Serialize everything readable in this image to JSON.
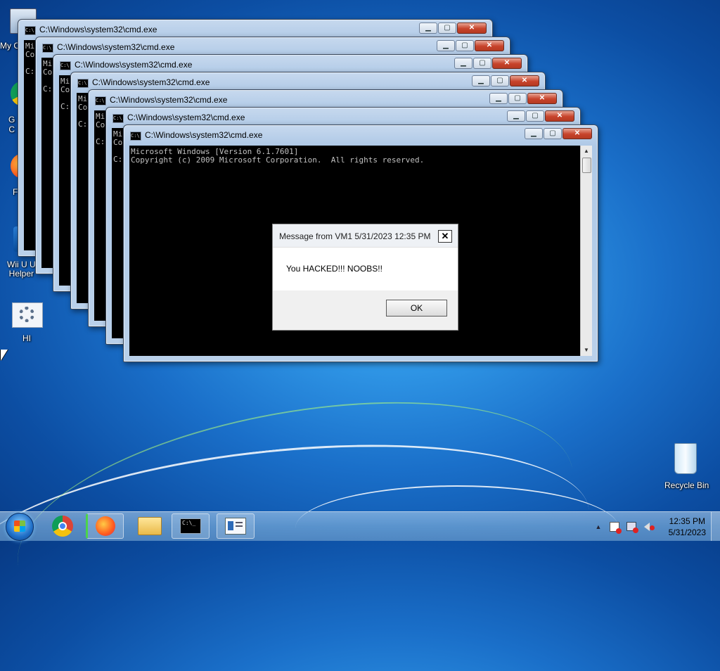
{
  "desktop": {
    "icons": [
      {
        "label": "My C"
      },
      {
        "label": "G\nC"
      },
      {
        "label": "F"
      },
      {
        "label": "Wii U U\nHelper"
      },
      {
        "label": "HI"
      },
      {
        "label": "Recycle Bin"
      }
    ]
  },
  "cmd": {
    "window_title": "C:\\Windows\\system32\\cmd.exe",
    "icon_text": "C:\\",
    "line1": "Microsoft Windows [Version 6.1.7601]",
    "line2": "Copyright (c) 2009 Microsoft Corporation.  All rights reserved.",
    "prompt": "C:",
    "partial_line1": "Mi",
    "partial_line2": "Co",
    "minimize_glyph": "▁",
    "maximize_glyph": "▢",
    "close_glyph": "✕",
    "scroll_up_glyph": "▲",
    "scroll_down_glyph": "▼"
  },
  "message_box": {
    "title": "Message from VM1 5/31/2023 12:35 PM",
    "body": "You HACKED!!! NOOBS!!",
    "ok_label": "OK",
    "close_glyph": "✕"
  },
  "taskbar": {
    "clock_time": "12:35 PM",
    "clock_date": "5/31/2023",
    "cmd_button_text": "C:\\_",
    "tray_arrow": "▲"
  }
}
